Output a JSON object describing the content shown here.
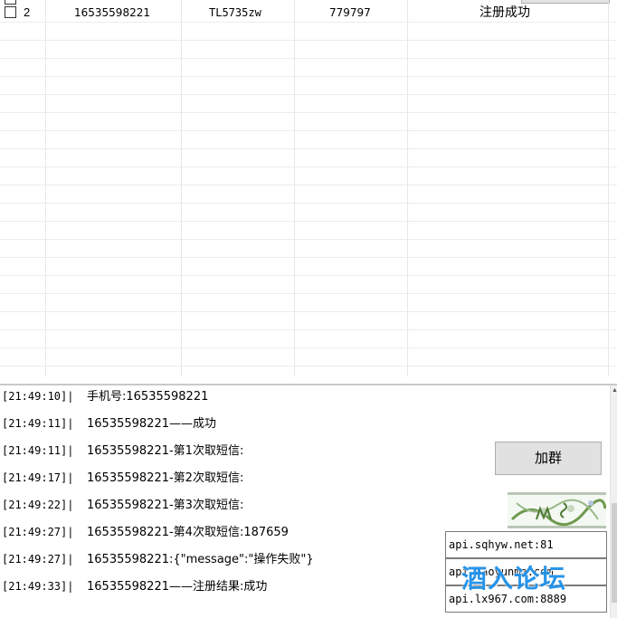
{
  "grid": {
    "rows": [
      {
        "checked": false,
        "index": "2",
        "phone": "16535598221",
        "account": "TL5735zw",
        "code": "779797",
        "status": "注册成功"
      }
    ]
  },
  "log": {
    "lines": [
      {
        "time": "[21:49:10]|",
        "text": "手机号:16535598221"
      },
      {
        "time": "[21:49:11]|",
        "text": "16535598221——成功"
      },
      {
        "time": "[21:49:11]|",
        "text": "16535598221-第1次取短信:"
      },
      {
        "time": "[21:49:17]|",
        "text": "16535598221-第2次取短信:"
      },
      {
        "time": "[21:49:22]|",
        "text": "16535598221-第3次取短信:"
      },
      {
        "time": "[21:49:27]|",
        "text": "16535598221-第4次取短信:187659"
      },
      {
        "time": "[21:49:27]|",
        "text": "16535598221:{\"message\":\"操作失败\"}"
      },
      {
        "time": "[21:49:33]|",
        "text": "16535598221——注册结果:成功"
      }
    ]
  },
  "actions": {
    "join_group_label": "加群"
  },
  "api_servers": {
    "items": [
      "api.sqhyw.net:81",
      "api.haoyunma.com",
      "api.lx967.com:8889"
    ]
  },
  "watermark": {
    "text": "酒入论坛"
  },
  "colors": {
    "grid_line": "#e6e6e6",
    "button_bg": "#e1e1e1",
    "watermark": "#1e90e8"
  }
}
